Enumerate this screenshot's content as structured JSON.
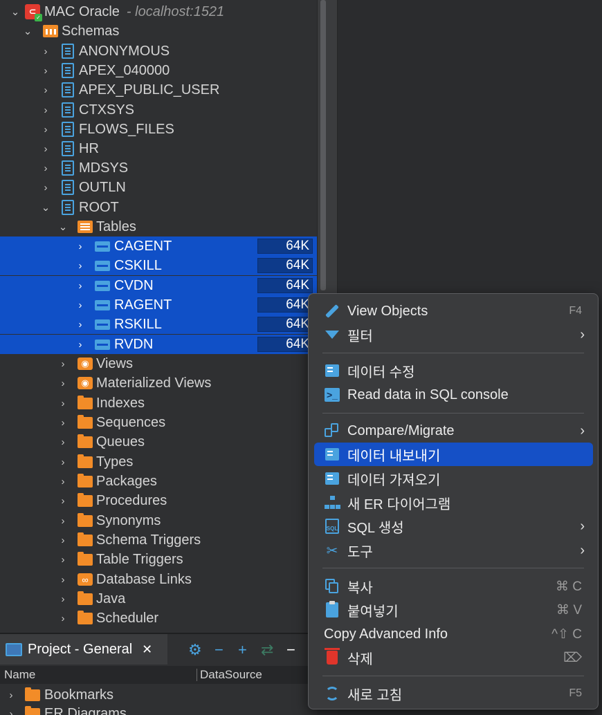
{
  "tree": {
    "connection": {
      "name": "MAC Oracle",
      "host": "- localhost:1521"
    },
    "schemas_label": "Schemas",
    "schemas": [
      "ANONYMOUS",
      "APEX_040000",
      "APEX_PUBLIC_USER",
      "CTXSYS",
      "FLOWS_FILES",
      "HR",
      "MDSYS",
      "OUTLN",
      "ROOT"
    ],
    "tables_label": "Tables",
    "tables": [
      {
        "name": "CAGENT",
        "size": "64K"
      },
      {
        "name": "CSKILL",
        "size": "64K"
      },
      {
        "name": "CVDN",
        "size": "64K"
      },
      {
        "name": "RAGENT",
        "size": "64K"
      },
      {
        "name": "RSKILL",
        "size": "64K"
      },
      {
        "name": "RVDN",
        "size": "64K"
      }
    ],
    "folders": [
      "Views",
      "Materialized Views",
      "Indexes",
      "Sequences",
      "Queues",
      "Types",
      "Packages",
      "Procedures",
      "Synonyms",
      "Schema Triggers",
      "Table Triggers",
      "Database Links",
      "Java",
      "Scheduler"
    ]
  },
  "project": {
    "tab_label": "Project - General",
    "close": "✕",
    "columns": {
      "name": "Name",
      "datasource": "DataSource"
    },
    "items": [
      "Bookmarks",
      "ER Diagrams"
    ]
  },
  "context_menu": {
    "view_objects": {
      "label": "View  Objects",
      "shortcut": "F4"
    },
    "filter": {
      "label": "필터"
    },
    "edit_data": {
      "label": "데이터 수정"
    },
    "read_sql": {
      "label": "Read data in SQL console"
    },
    "compare": {
      "label": "Compare/Migrate"
    },
    "export": {
      "label": "데이터 내보내기"
    },
    "import": {
      "label": "데이터 가져오기"
    },
    "new_er": {
      "label": "새 ER 다이어그램"
    },
    "sql_gen": {
      "label": "SQL 생성"
    },
    "tools": {
      "label": "도구"
    },
    "copy": {
      "label": "복사",
      "shortcut": "⌘ C"
    },
    "paste": {
      "label": "붙여넣기",
      "shortcut": "⌘ V"
    },
    "copy_adv": {
      "label": "Copy Advanced Info",
      "shortcut": "^⇧ C"
    },
    "delete": {
      "label": "삭제",
      "shortcut": "⌦"
    },
    "refresh": {
      "label": "새로 고침",
      "shortcut": "F5"
    }
  },
  "colors": {
    "selection": "#1050c7",
    "accent": "#4aa3df",
    "folder": "#f28c28"
  }
}
